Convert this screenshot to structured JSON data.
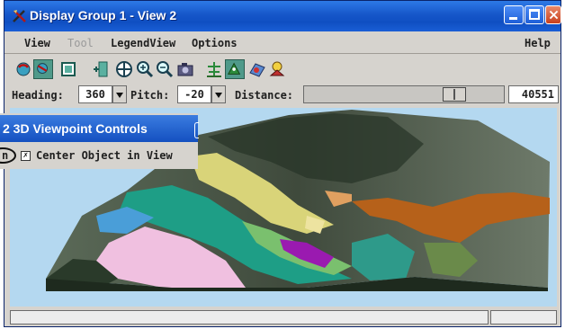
{
  "window": {
    "title": "Display Group 1 - View 2",
    "controls": [
      "minimize-icon",
      "maximize-icon",
      "close-icon"
    ]
  },
  "menubar": {
    "items": [
      {
        "label": "View",
        "enabled": true
      },
      {
        "label": "Tool",
        "enabled": false
      },
      {
        "label": "LegendView",
        "enabled": true
      },
      {
        "label": "Options",
        "enabled": true
      }
    ],
    "help": "Help"
  },
  "toolbar": {
    "icons": [
      "rotate-view-icon",
      "fly-view-icon",
      "frame-icon",
      "add-layer-icon",
      "pan-icon",
      "zoom-in-icon",
      "zoom-out-icon",
      "snapshot-icon",
      "tree-icon",
      "viewpoint-3d-icon",
      "surface-icon",
      "lighting-icon"
    ]
  },
  "view_controls": {
    "heading_label": "Heading:",
    "heading_value": "360",
    "pitch_label": "Pitch:",
    "pitch_value": "-20",
    "distance_label": "Distance:",
    "distance_value": "40551"
  },
  "dialog": {
    "title": "2 3D Viewpoint Controls",
    "left_fragment": "n",
    "checkbox_label": "Center Object in View",
    "checkbox_checked": true
  },
  "colors": {
    "title_blue": "#0f4fc2",
    "chrome": "#d6d3ce",
    "sky": "#b4d8f0"
  }
}
